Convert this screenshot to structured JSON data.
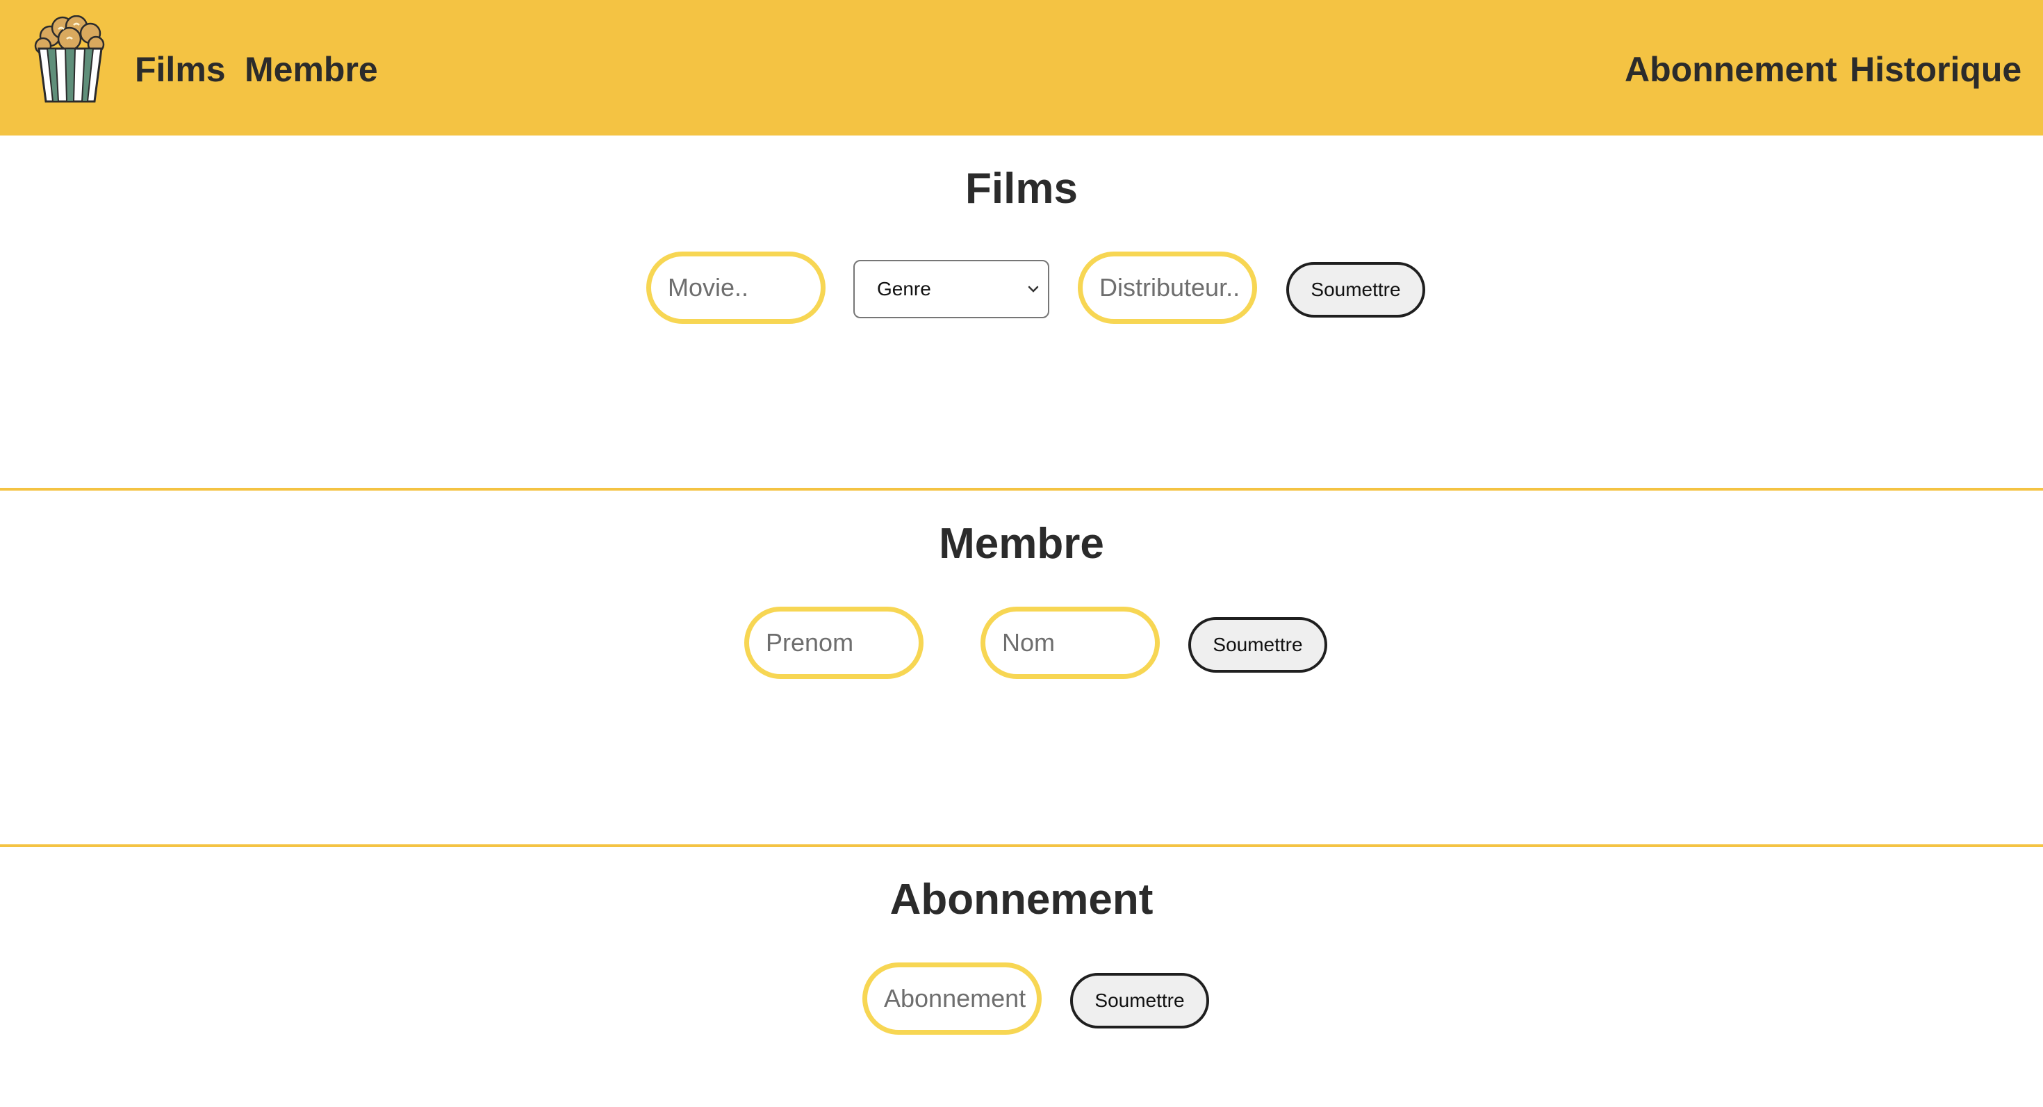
{
  "nav": {
    "left_links": [
      "Films",
      "Membre"
    ],
    "right_links": [
      "Abonnement",
      "Historique"
    ],
    "logo_icon": "popcorn-icon",
    "bar_color": "#f4c343"
  },
  "films": {
    "title": "Films",
    "movie_placeholder": "Movie..",
    "genre_selected": "Genre",
    "distributor_placeholder": "Distributeur..",
    "submit_label": "Soumettre"
  },
  "membre": {
    "title": "Membre",
    "prenom_placeholder": "Prenom",
    "nom_placeholder": "Nom",
    "submit_label": "Soumettre"
  },
  "abonnement": {
    "title": "Abonnement",
    "abonnement_placeholder": "Abonnement",
    "submit_label": "Soumettre"
  },
  "colors": {
    "accent": "#f4c343",
    "input_border": "#f7d653"
  }
}
